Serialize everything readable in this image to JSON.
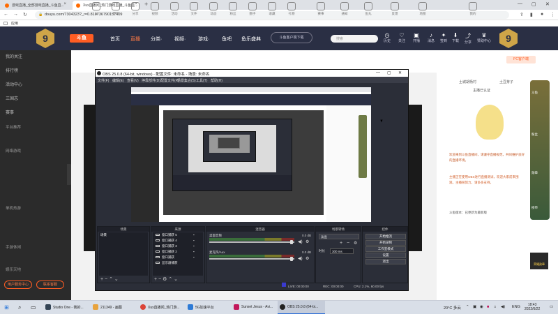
{
  "browser": {
    "tabs": [
      "游戏直播_全部游戏直播_斗鱼直...",
      "Xux直播间_热门游戏直播_斗鱼直..."
    ],
    "url": "douyu.com/7304323?_r=0.819736790157409",
    "bookmarks_label": "应用"
  },
  "douyu": {
    "logo": "斗鱼",
    "badge": "9",
    "nav": [
      "首页",
      "直播",
      "分类·",
      "视频·",
      "游戏·",
      "鱼吧",
      "鱼乐盛典"
    ],
    "download_label": "斗鱼客户端下载",
    "search_placeholder": "搜索",
    "header_icons": [
      "历史",
      "关注",
      "开播",
      "消息",
      "签到",
      "下载",
      "分享",
      "赞助中心"
    ],
    "sidebar": {
      "items": [
        "我的关注",
        "排行榜",
        "活动中心",
        "三国志",
        "赛事"
      ],
      "sections": [
        "平台推荐",
        "网络游戏",
        "单机热游",
        "手游休闲",
        "娱乐天地"
      ],
      "buttons": [
        "用户服务中心",
        "联系客服"
      ]
    },
    "categories": [
      "11",
      "签到",
      "分享",
      "视频",
      "活动",
      "文件",
      "动态",
      "粉丝",
      "圈子",
      "收藏",
      "礼物",
      "赛事",
      "通知",
      "鱼丸",
      "反馈",
      "地图",
      "我的"
    ],
    "pc_button": "PC客户端",
    "chat": {
      "head1": "土城胡杨村",
      "head2": "土豆芽子",
      "head3": "主播已认证",
      "notice": "欢迎来到斗鱼直播间，请遵守直播规范，共同维护良好的直播环境。",
      "lines": "主播正在使用OBS进行直播测试，欢迎大家前来围观，主播很努力，请多多支持。",
      "foot": "斗鱼版本：已更新为最新版"
    },
    "medal_texts": [
      "斗鱼",
      "粉丝",
      "勋章",
      "榜单"
    ],
    "bottom_badge": "荣耀勋章"
  },
  "obs": {
    "title": "OBS 25.0.8 (64-bit, windows) - 配置文件: 未命名 - 场景: 未命名",
    "menu": [
      "文件(F)",
      "编辑(E)",
      "查看(V)",
      "停靠部件(D)",
      "配置文件(P)",
      "场景集合(S)",
      "工具(T)",
      "帮助(H)"
    ],
    "docks": {
      "scenes": "场景",
      "sources": "来源",
      "mixer": "混音器",
      "transitions": "场景转场",
      "controls": "控件"
    },
    "scene_name": "场景",
    "sources": [
      "窗口捕获 5",
      "窗口捕获 4",
      "窗口捕获 3",
      "窗口捕获 2",
      "窗口捕获",
      "显示器捕获"
    ],
    "mixer": [
      {
        "label": "桌面音频",
        "db": "0.0 dB"
      },
      {
        "label": "麦克风/Aux",
        "db": "0.0 dB"
      }
    ],
    "transition": {
      "selected": "淡出",
      "duration_label": "时长",
      "duration": "300 ms"
    },
    "controls": [
      "开始推流",
      "开始录制",
      "工作室模式",
      "设置",
      "退出"
    ],
    "status": {
      "live": "LIVE: 00:00:00",
      "rec": "REC: 00:00:00",
      "cpu": "CPU: 2.1%, 60.00 fps"
    }
  },
  "taskbar": {
    "apps": [
      "Studio One - 我的...",
      "211349 - 画图",
      "Xux直播间_热门游...",
      "5G加速平台",
      "Sunset Jesus - Avi...",
      "OBS 25.0.8 (64-bi..."
    ],
    "weather": "20°C 多云",
    "lang": "ENG",
    "time": "18:43",
    "date": "2022/6/22"
  }
}
